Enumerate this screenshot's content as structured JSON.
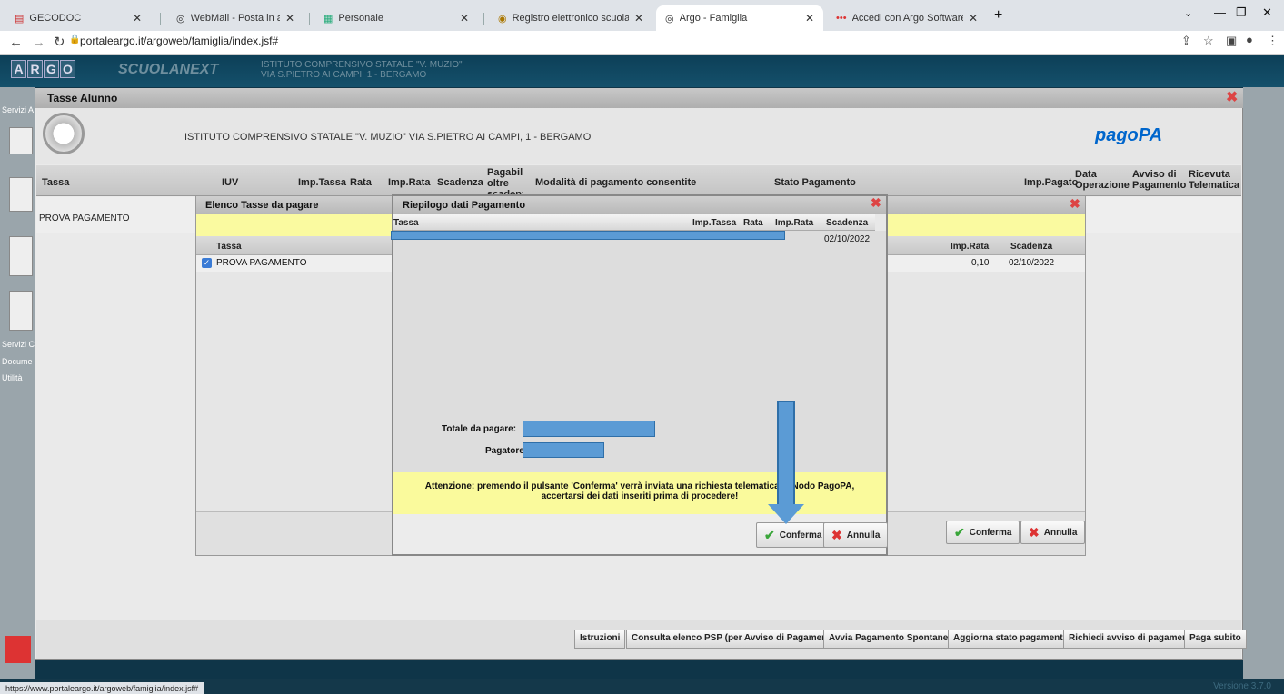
{
  "browser": {
    "tabs": [
      {
        "title": "GECODOC",
        "icon": "doc-icon"
      },
      {
        "title": "WebMail - Posta in arrivo - bgic",
        "icon": "globe-icon"
      },
      {
        "title": "Personale",
        "icon": "chart-icon"
      },
      {
        "title": "Registro elettronico scuola",
        "icon": "school-icon"
      },
      {
        "title": "Argo - Famiglia",
        "icon": "globe-icon"
      },
      {
        "title": "Accedi con Argo Software",
        "icon": "argo-icon"
      }
    ],
    "url": "portaleargo.it/argoweb/famiglia/index.jsf#",
    "status_url": "https://www.portaleargo.it/argoweb/famiglia/index.jsf#"
  },
  "app": {
    "logo_letters": [
      "A",
      "R",
      "G",
      "O"
    ],
    "product": "SCUOLANEXT",
    "school_line1": "ISTITUTO COMPRENSIVO STATALE \"V. MUZIO\"",
    "school_line2": "VIA S.PIETRO AI CAMPI, 1 - BERGAMO",
    "left_labels": [
      "Servizi A",
      "Servizi C",
      "Docume",
      "Utilità"
    ],
    "version": "Versione 3.7.0"
  },
  "main": {
    "title": "Tasse Alunno",
    "school": "ISTITUTO COMPRENSIVO STATALE \"V. MUZIO\" VIA S.PIETRO AI CAMPI, 1 - BERGAMO",
    "pagopa": "pagoPA",
    "columns": [
      "Tassa",
      "IUV",
      "Imp.Tassa",
      "Rata",
      "Imp.Rata",
      "Scadenza",
      "Pagabile oltre scadenza",
      "Modalità di pagamento consentite",
      "Stato Pagamento",
      "Imp.Pagato",
      "Data Operazione",
      "Avviso di Pagamento",
      "Ricevuta Telematica"
    ],
    "row": "PROVA PAGAMENTO"
  },
  "elenco": {
    "title": "Elenco Tasse da pagare",
    "col_tassa": "Tassa",
    "col_imprata": "Imp.Rata",
    "col_scadenza": "Scadenza",
    "row_tassa": "PROVA PAGAMENTO",
    "row_imprata": "0,10",
    "row_scadenza": "02/10/2022",
    "confirm": "Conferma",
    "cancel": "Annulla"
  },
  "riepilogo": {
    "title": "Riepilogo dati Pagamento",
    "cols": [
      "Tassa",
      "Imp.Tassa",
      "Rata",
      "Imp.Rata",
      "Scadenza"
    ],
    "row_scadenza": "02/10/2022",
    "totale_label": "Totale da pagare:",
    "pagatore_label": "Pagatore:",
    "warning": "Attenzione: premendo il pulsante 'Conferma' verrà inviata una richiesta telematica al Nodo PagoPA, accertarsi dei dati inseriti prima di procedere!",
    "confirm": "Conferma",
    "cancel": "Annulla"
  },
  "toolbar": [
    "Istruzioni",
    "Consulta elenco PSP (per Avviso di Pagamento)",
    "Avvia Pagamento Spontaneo",
    "Aggiorna stato pagamenti",
    "Richiedi avviso di pagamento",
    "Paga subito"
  ]
}
